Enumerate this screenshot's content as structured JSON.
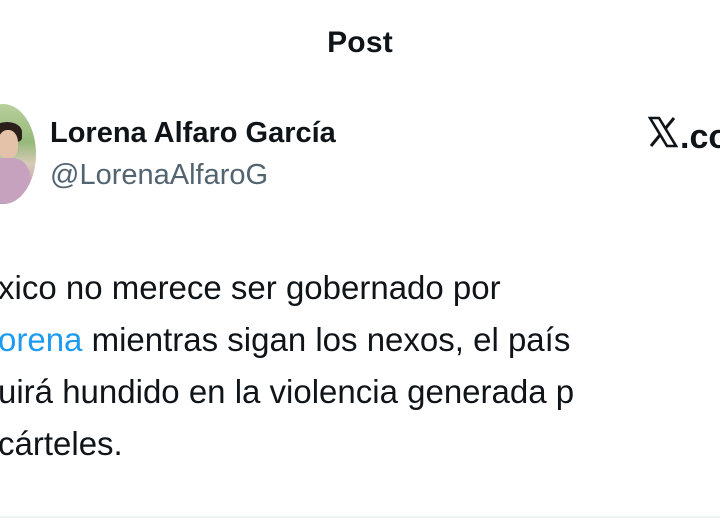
{
  "header": {
    "title": "Post"
  },
  "author": {
    "name": "Lorena Alfaro García",
    "handle": "@LorenaAlfaroG",
    "avatar_icon": "profile-photo"
  },
  "brand": {
    "icon": "x-logo-icon",
    "text": ".co"
  },
  "post": {
    "lines": [
      {
        "text": "xico no merece ser gobernado por"
      },
      {
        "mention": "orena",
        "rest": " mientras sigan los nexos, el país"
      },
      {
        "text": "uirá hundido en la violencia generada p"
      },
      {
        "text": "cárteles."
      }
    ]
  },
  "colors": {
    "text": "#0f1419",
    "handle": "#536471",
    "mention": "#1d9bf0",
    "divider": "#eff3f4"
  }
}
